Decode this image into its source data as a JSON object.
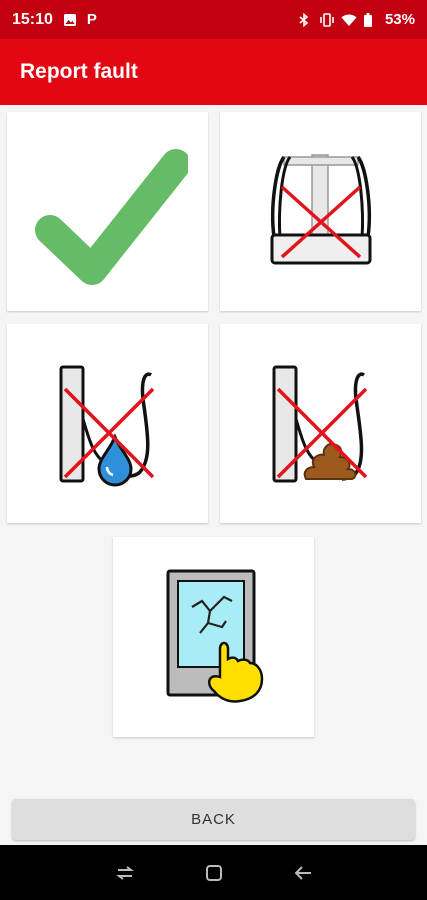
{
  "status_bar": {
    "time": "15:10",
    "battery": "53%",
    "icons": [
      "image-icon",
      "parking-icon",
      "bluetooth-icon",
      "vibrate-icon",
      "wifi-icon",
      "battery-icon"
    ]
  },
  "app_bar": {
    "title": "Report fault"
  },
  "tiles": [
    {
      "icon": "checkmark-icon",
      "meaning": "ok"
    },
    {
      "icon": "paper-holder-crossed-icon"
    },
    {
      "icon": "urinal-water-crossed-icon"
    },
    {
      "icon": "urinal-poop-crossed-icon"
    },
    {
      "icon": "broken-touchscreen-icon"
    }
  ],
  "back_button": {
    "label": "BACK"
  },
  "colors": {
    "status_bar": "#c20010",
    "app_bar": "#e30613",
    "check_green": "#66bb66",
    "cross_red": "#e3131b",
    "water_blue": "#2f8fd8",
    "poop_brown": "#9c5a1f",
    "screen_cyan": "#a8ecf5",
    "hand_yellow": "#ffe000"
  },
  "nav_bar": {
    "buttons": [
      "recents-icon",
      "home-icon",
      "back-arrow-icon"
    ]
  }
}
